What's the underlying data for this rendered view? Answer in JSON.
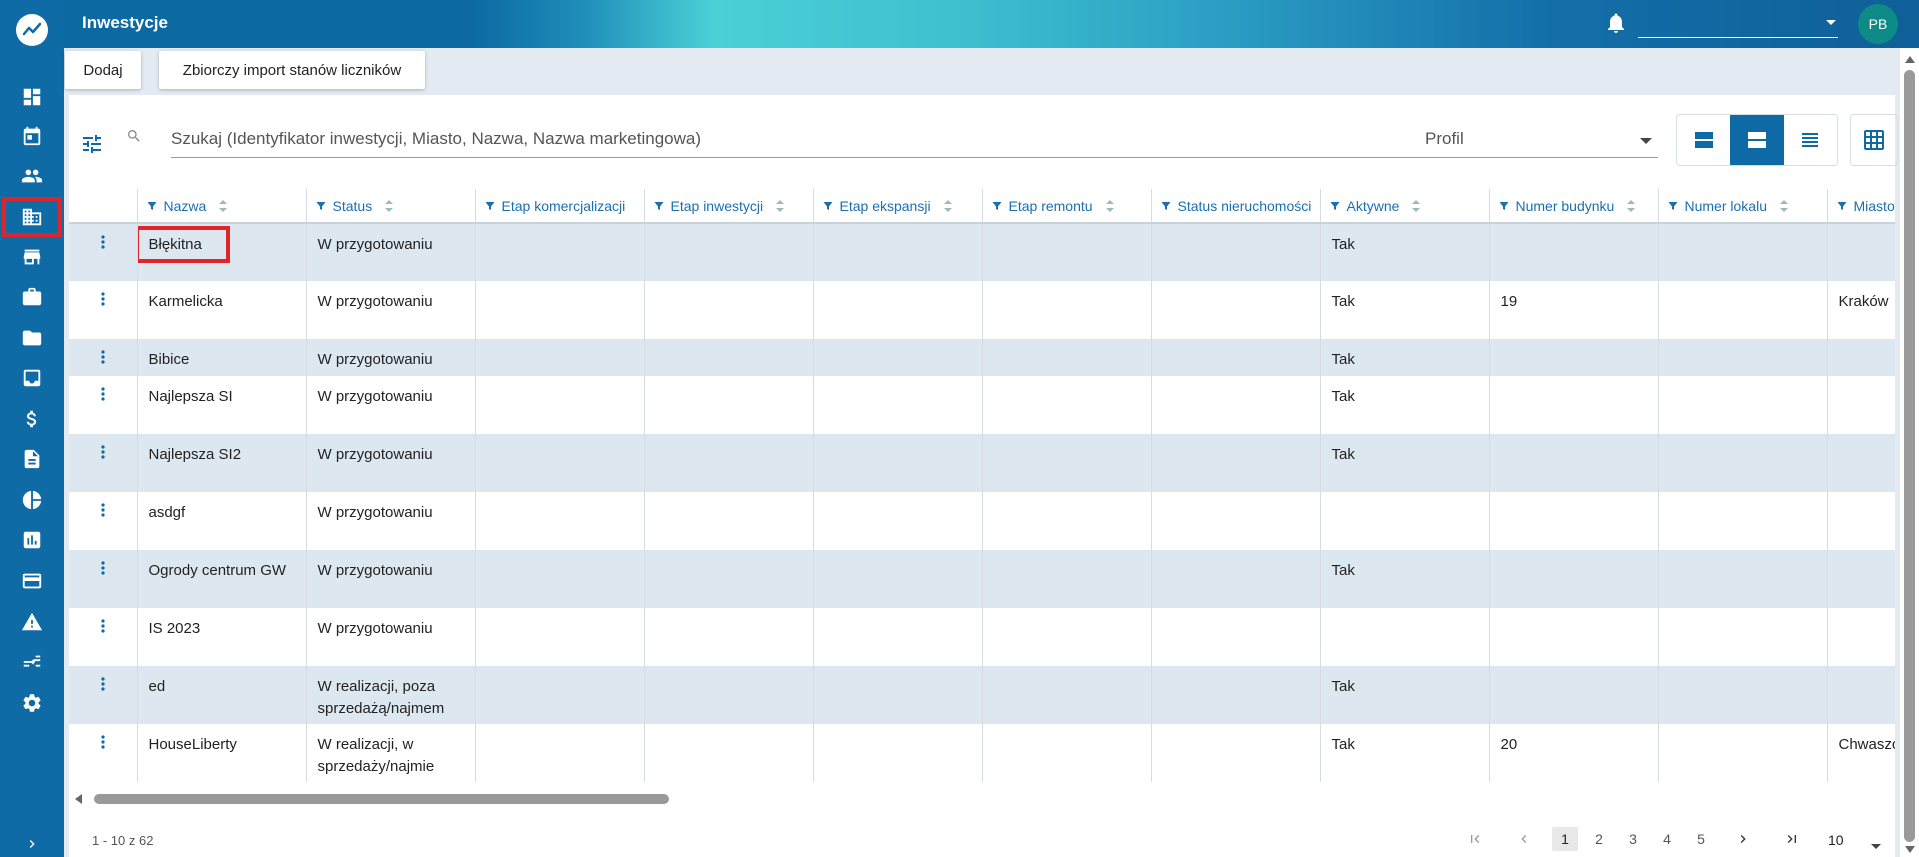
{
  "header": {
    "title": "Inwestycje",
    "avatar_initials": "PB"
  },
  "actions": {
    "add_label": "Dodaj",
    "import_label": "Zbiorczy import stanów liczników"
  },
  "toolbar": {
    "search_placeholder": "Szukaj (Identyfikator inwestycji, Miasto, Nazwa, Nazwa marketingowa)",
    "profile_placeholder": "Profil"
  },
  "sidebar": {
    "items": [
      {
        "icon": "dashboard-icon"
      },
      {
        "icon": "calendar-icon"
      },
      {
        "icon": "people-icon"
      },
      {
        "icon": "building-icon",
        "active": true
      },
      {
        "icon": "store-icon"
      },
      {
        "icon": "briefcase-icon"
      },
      {
        "icon": "folder-icon"
      },
      {
        "icon": "inbox-icon"
      },
      {
        "icon": "dollar-icon"
      },
      {
        "icon": "document-icon"
      },
      {
        "icon": "pie-chart-icon"
      },
      {
        "icon": "bar-chart-icon"
      },
      {
        "icon": "credit-card-icon"
      },
      {
        "icon": "warning-icon"
      },
      {
        "icon": "transfer-icon"
      },
      {
        "icon": "settings-icon"
      }
    ]
  },
  "table": {
    "columns": [
      "Nazwa",
      "Status",
      "Etap komercjalizacji",
      "Etap inwestycji",
      "Etap ekspansji",
      "Etap remontu",
      "Status nieruchomości",
      "Aktywne",
      "Numer budynku",
      "Numer lokalu",
      "Miasto"
    ],
    "rows": [
      {
        "nazwa": "Błękitna",
        "status": "W przygotowaniu",
        "aktywne": "Tak",
        "numer_budynku": "",
        "miasto": ""
      },
      {
        "nazwa": "Karmelicka",
        "status": "W przygotowaniu",
        "aktywne": "Tak",
        "numer_budynku": "19",
        "miasto": "Kraków"
      },
      {
        "nazwa": "Bibice",
        "status": "W przygotowaniu",
        "aktywne": "Tak",
        "numer_budynku": "",
        "miasto": ""
      },
      {
        "nazwa": "Najlepsza SI",
        "status": "W przygotowaniu",
        "aktywne": "Tak",
        "numer_budynku": "",
        "miasto": ""
      },
      {
        "nazwa": "Najlepsza SI2",
        "status": "W przygotowaniu",
        "aktywne": "Tak",
        "numer_budynku": "",
        "miasto": ""
      },
      {
        "nazwa": "asdgf",
        "status": "W przygotowaniu",
        "aktywne": "",
        "numer_budynku": "",
        "miasto": ""
      },
      {
        "nazwa": "Ogrody centrum GW",
        "status": "W przygotowaniu",
        "aktywne": "Tak",
        "numer_budynku": "",
        "miasto": ""
      },
      {
        "nazwa": "IS 2023",
        "status": "W przygotowaniu",
        "aktywne": "",
        "numer_budynku": "",
        "miasto": ""
      },
      {
        "nazwa": "ed",
        "status": "W realizacji, poza sprzedażą/najmem",
        "aktywne": "Tak",
        "numer_budynku": "",
        "miasto": ""
      },
      {
        "nazwa": "HouseLiberty",
        "status": "W realizacji, w sprzedaży/najmie",
        "aktywne": "Tak",
        "numer_budynku": "20",
        "miasto": "Chwaszczyno"
      }
    ]
  },
  "pagination": {
    "range_text": "1 - 10 z 62",
    "pages": [
      "1",
      "2",
      "3",
      "4",
      "5"
    ],
    "current_page": "1",
    "page_size": "10"
  },
  "colors": {
    "primary": "#0e6aa4",
    "header_accent": "#4bd0d6",
    "row_alt": "#dde7f0",
    "highlight": "#e0252a"
  }
}
